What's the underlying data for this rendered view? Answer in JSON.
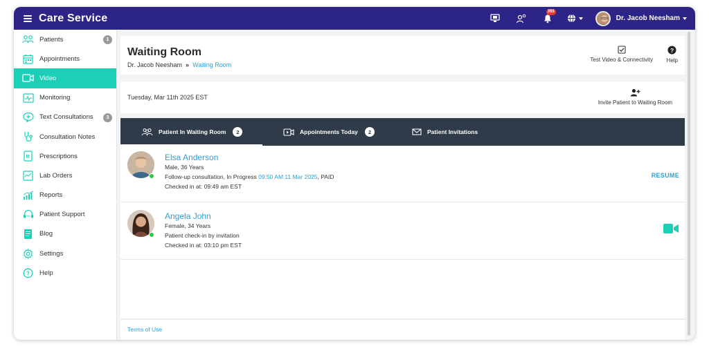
{
  "app": {
    "title": "Care Service"
  },
  "topbar": {
    "notification_count": "393",
    "user_name": "Dr. Jacob Neesham",
    "icons": [
      "monitor-icon",
      "user-network-icon",
      "bell-icon",
      "globe-icon"
    ]
  },
  "sidebar": {
    "items": [
      {
        "label": "Patients",
        "icon": "patients-icon",
        "badge": "1"
      },
      {
        "label": "Appointments",
        "icon": "calendar-icon",
        "badge": ""
      },
      {
        "label": "Video",
        "icon": "video-icon",
        "badge": "",
        "active": true
      },
      {
        "label": "Monitoring",
        "icon": "monitoring-icon",
        "badge": ""
      },
      {
        "label": "Text Consultations",
        "icon": "chat-icon",
        "badge": "3"
      },
      {
        "label": "Consultation Notes",
        "icon": "stethoscope-icon",
        "badge": ""
      },
      {
        "label": "Prescriptions",
        "icon": "prescription-icon",
        "badge": ""
      },
      {
        "label": "Lab Orders",
        "icon": "lab-icon",
        "badge": ""
      },
      {
        "label": "Reports",
        "icon": "reports-icon",
        "badge": ""
      },
      {
        "label": "Patient Support",
        "icon": "support-icon",
        "badge": ""
      },
      {
        "label": "Blog",
        "icon": "blog-icon",
        "badge": ""
      },
      {
        "label": "Settings",
        "icon": "settings-icon",
        "badge": ""
      },
      {
        "label": "Help",
        "icon": "help-icon",
        "badge": ""
      }
    ]
  },
  "header": {
    "title": "Waiting Room",
    "breadcrumb_root": "Dr. Jacob Neesham",
    "breadcrumb_sep": "»",
    "breadcrumb_current": "Waiting Room",
    "test_video_label": "Test Video & Connectivity",
    "help_label": "Help"
  },
  "date_bar": {
    "date": "Tuesday, Mar 11th 2025 EST",
    "invite_label": "Invite Patient to Waiting Room"
  },
  "tabs": [
    {
      "label": "Patient In Waiting Room",
      "count": "2",
      "active": true
    },
    {
      "label": "Appointments Today",
      "count": "2",
      "active": false
    },
    {
      "label": "Patient Invitations",
      "count": "",
      "active": false
    }
  ],
  "patients": [
    {
      "name": "Elsa Anderson",
      "demographics": "Male, 36 Years",
      "status_prefix": "Follow-up consultation, In Progress ",
      "status_time": "09:50 AM 11 Mar 2025",
      "status_suffix": ", PAID",
      "checked_in": "Checked in at: 09:49 am EST",
      "action": "RESUME"
    },
    {
      "name": "Angela John",
      "demographics": "Female, 34 Years",
      "status_prefix": "Patient check-in by invitation",
      "status_time": "",
      "status_suffix": "",
      "checked_in": "Checked in at: 03:10 pm EST",
      "action": "video-camera-icon"
    }
  ],
  "footer": {
    "terms": "Terms of Use"
  },
  "colors": {
    "topbar": "#2c2486",
    "accent": "#1ecfb8",
    "link": "#2a9fd6",
    "tabs_bg": "#2f3b48",
    "badge_red": "#e53935"
  }
}
